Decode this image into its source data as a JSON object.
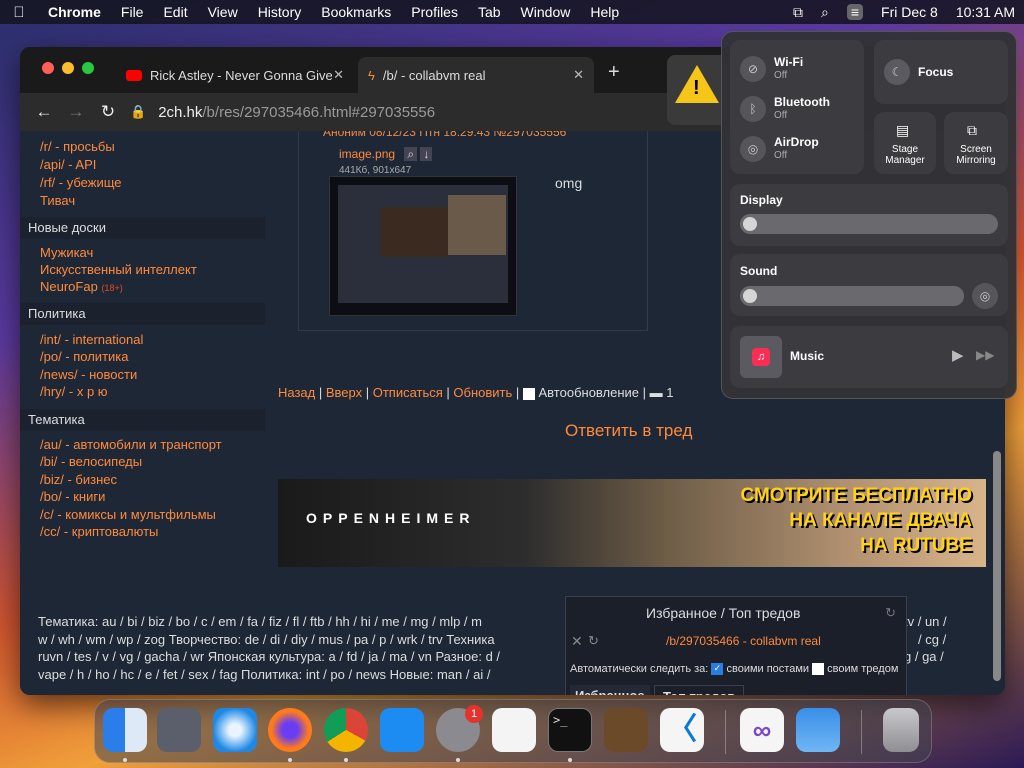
{
  "menubar": {
    "app": "Chrome",
    "items": [
      "File",
      "Edit",
      "View",
      "History",
      "Bookmarks",
      "Profiles",
      "Tab",
      "Window",
      "Help"
    ],
    "date": "Fri Dec 8",
    "time": "10:31 AM"
  },
  "tabs": [
    {
      "title": "Rick Astley - Never Gonna Give"
    },
    {
      "title": "/b/ - collabvm real"
    }
  ],
  "address": {
    "host": "2ch.hk",
    "path": "/b/res/297035466.html#297035556"
  },
  "sidebar": {
    "links_top": [
      "/r/ - просьбы",
      "/api/ - API",
      "/rf/ - убежище",
      "Тивач"
    ],
    "new_boards_title": "Новые доски",
    "new_boards": [
      "Мужикач",
      "Искусственный интеллект",
      "NeuroFap"
    ],
    "neurofap_tag": "(18+)",
    "politics_title": "Политика",
    "politics": [
      "/int/ - international",
      "/po/ - политика",
      "/news/ - новости",
      "/hry/ - х р ю"
    ],
    "topics_title": "Тематика",
    "topics": [
      "/au/ - автомобили и транспорт",
      "/bi/ - велосипеды",
      "/biz/ - бизнес",
      "/bo/ - книги",
      "/c/ - комиксы и мультфильмы",
      "/cc/ - криптовалюты"
    ]
  },
  "post": {
    "header": "Аноним 08/12/23 Птн 18:29:43 №297035556",
    "file": "image.png",
    "meta": "441Кб, 901x647",
    "text": "omg"
  },
  "postbar": {
    "back": "Назад",
    "top": "Вверх",
    "unsub": "Отписаться",
    "update": "Обновить",
    "auto": "Автообновление",
    "count": "1"
  },
  "reply": "Ответить в тред",
  "banner": {
    "movie": "OPPENHEIMER",
    "line1": "СМОТРИТЕ БЕСПЛАТНО",
    "line2": "НА КАНАЛЕ ДВАЧА",
    "line3": "НА RUTUBE"
  },
  "footer": {
    "line1": "Тематика: au / bi / biz / bo / c / em / fa / fiz / fl / ftb / hh / hi / me / mg / mlp / m",
    "line1_tail": "tv / un /",
    "line2": "w / wh / wm / wp / zog Творчество: de / di / diy / mus / pa / p / wrk / trv Техника",
    "line2_tail": "/ cg /",
    "line3": "ruvn / tes / v / vg / gacha / wr Японская культура: a / fd / ja / ma / vn Разное: d /",
    "line3_tail": "g / ga /",
    "line4": "vape / h / ho / hc / e / fet / sex / fag Политика: int / po / news Новые: man / ai /"
  },
  "favorites": {
    "title": "Избранное / Топ тредов",
    "thread": "/b/297035466 - collabvm real",
    "auto_label": "Автоматически следить за:",
    "opt1": "своими постами",
    "opt2": "своим тредом",
    "tab1": "Избранное",
    "tab2": "Топ тредов"
  },
  "control_center": {
    "wifi": "Wi-Fi",
    "wifi_state": "Off",
    "bluetooth": "Bluetooth",
    "bluetooth_state": "Off",
    "airdrop": "AirDrop",
    "airdrop_state": "Off",
    "focus": "Focus",
    "stage": "Stage Manager",
    "mirror": "Screen Mirroring",
    "display": "Display",
    "sound": "Sound",
    "music": "Music"
  },
  "dock": {
    "settings_badge": "1"
  }
}
